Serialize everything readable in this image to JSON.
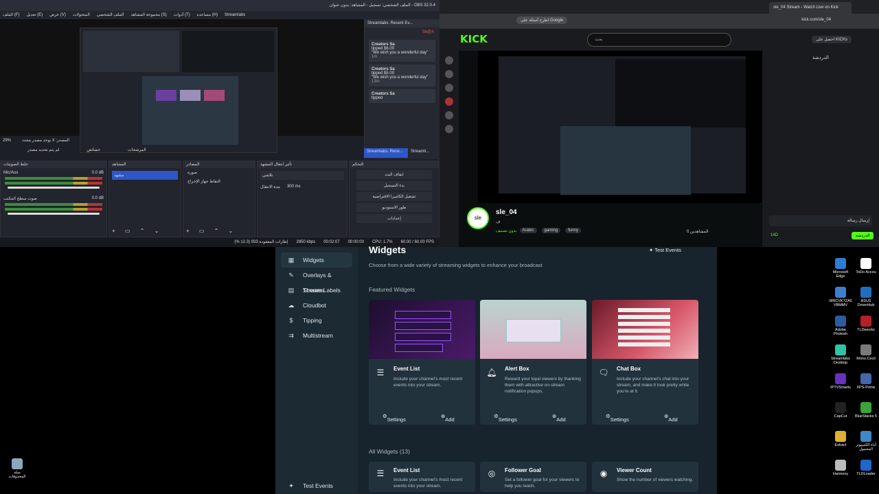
{
  "obs": {
    "title": "OBS 32.0.4 - الملف الشخصي: تسجيل - المشاهد: بدون عنوان",
    "menu": [
      "الملف (F)",
      "تعديل (E)",
      "عرض (V)",
      "المتحولات",
      "الملف الشخصي",
      "مجموعة المشاهد (S)",
      "أدوات (T)",
      "مساعدة (H)",
      "Streamlabs"
    ],
    "dock_title": "Streamlabs: Recent Ev...",
    "events": [
      {
        "name": "Creators Sa",
        "action": "tipped $6.00",
        "msg": "\"We wish you a wonderful day\"",
        "time": "1m"
      },
      {
        "name": "Creators Sa",
        "action": "tipped $5.00",
        "msg": "\"We wish you a wonderful day\"",
        "time": "13m"
      },
      {
        "name": "Creators Sa",
        "action": "tipped",
        "msg": "",
        "time": ""
      }
    ],
    "dock_tabs": [
      "Streamlabs: Rece...",
      "Streamli..."
    ],
    "zoom": "29%",
    "preview_label": "المصدر: لا يوجد مصدر محدد",
    "filters_btn": "المرشحات",
    "props_btn": "خصائص",
    "program_btn": "لم يتم تحديد مصدر",
    "panels": {
      "mixer": "خلط الصوتيات",
      "scenes": "المشاهد",
      "sources": "المصادر",
      "transitions": "تأثير انتقال المشهد",
      "controls": "التحكم"
    },
    "mixer_tracks": [
      {
        "name": "Mic/Aux",
        "db": "0.0 dB"
      },
      {
        "name": "صوت سطح المكتب",
        "db": "0.0 dB"
      }
    ],
    "scene_item": "مشهد",
    "source_items": [
      "صورة",
      "التقاط جهاز الإخراج"
    ],
    "transition_type": "تلاشي",
    "transition_duration_label": "مدة الانتقال",
    "transition_duration": "300 ms",
    "controls": [
      "ايقاف البث",
      "بدء التسجيل",
      "تشغيل الكاميرا الافتراضية",
      "طور الاستوديو",
      "إعدادات"
    ],
    "status": {
      "dropped": "إطارات المفقودة 933 (12.3 %)",
      "kbps": "2850 kbps",
      "rec_time": "00:02:07",
      "stream_time": "00:00:00",
      "cpu": "CPU: 1.7%",
      "fps": "60.00 / 60.00 FPS"
    }
  },
  "browser": {
    "tab_title": "sle_04 Stream - Watch Live on Kick",
    "bookmark": "اطرح أسئلة على Google",
    "url": "kick.com/sle_04",
    "logo": "KICK",
    "search_placeholder": "بحث",
    "get_btn": "احصل على KICKs",
    "chat_header": "الدردشة",
    "channel": {
      "name": "sle_04",
      "subtitle": "ف",
      "category": "بدون تصنيف",
      "tags": [
        "Arabic",
        "gaming",
        "funny"
      ],
      "viewers": "0 المشاهدين",
      "avatar_text": "sle"
    },
    "chat_placeholder": "إرسال رسالة",
    "chat_btn": "الدردشة",
    "kicks": "14D"
  },
  "streamlabs": {
    "sidebar": [
      "Widgets",
      "Overlays & Themes",
      "Stream Labels",
      "Cloudbot",
      "Tipping",
      "Multistream"
    ],
    "test_events_side": "Test Events",
    "title": "Widgets",
    "subtitle": "Choose from a wide variety of streaming widgets to enhance your broadcast",
    "test_events_btn": "Test Events",
    "featured_label": "Featured Widgets",
    "all_label": "All Widgets (13)",
    "featured": [
      {
        "title": "Event List",
        "desc": "Include your channel's most recent events into your stream.",
        "icon": "list-icon"
      },
      {
        "title": "Alert Box",
        "desc": "Reward your loyal viewers by thanking them with attractive on-stream notification popups.",
        "icon": "bell-icon"
      },
      {
        "title": "Chat Box",
        "desc": "Include your channel's chat into your stream, and make it look pretty while you're at it.",
        "icon": "chat-icon"
      }
    ],
    "all": [
      {
        "title": "Event List",
        "desc": "Include your channel's most recent events into your stream.",
        "icon": "list-icon"
      },
      {
        "title": "Follower Goal",
        "desc": "Set a follower goal for your viewers to help you reach.",
        "icon": "goal-icon"
      },
      {
        "title": "Viewer Count",
        "desc": "Show the number of viewers watching.",
        "icon": "eye-icon"
      }
    ],
    "settings": "Settings",
    "add": "Add"
  },
  "desktop": {
    "icons": [
      {
        "label": "Microsoft Edge",
        "color": "#2a7fd4"
      },
      {
        "label": "ToDo Accou",
        "color": "#ffffff"
      },
      {
        "label": "WRCVK7ZA5 VBMMV",
        "color": "#3b7fd1"
      },
      {
        "label": "ASUS DriverHub",
        "color": "#1f6fc1"
      },
      {
        "label": "Adobe Photosh",
        "color": "#2b5ba3"
      },
      {
        "label": "TLDwecks",
        "color": "#b3202a"
      },
      {
        "label": "Streamlabs Desktop",
        "color": "#31c3a2"
      },
      {
        "label": "Mono.Cecil",
        "color": "#7a7a7a"
      },
      {
        "label": "IPTVSmarts",
        "color": "#6a2fbf"
      },
      {
        "label": "XPS-Prime",
        "color": "#4466aa"
      },
      {
        "label": "CapCut",
        "color": "#222222"
      },
      {
        "label": "BlueStacks 5",
        "color": "#3aa33a"
      },
      {
        "label": "Extract",
        "color": "#e0b030"
      },
      {
        "label": "أداء الكمبيوتر المحمول",
        "color": "#3e88c8"
      },
      {
        "label": "Harmony",
        "color": "#bbbbbb"
      },
      {
        "label": "TLDLoader",
        "color": "#2266cc"
      }
    ],
    "recycle": "سلة المحذوفات"
  },
  "colors": {
    "kick_green": "#53fc18",
    "obs_bg": "#1d1f26",
    "sl_bg": "#17242d",
    "scene_selected": "#2d56c8"
  }
}
